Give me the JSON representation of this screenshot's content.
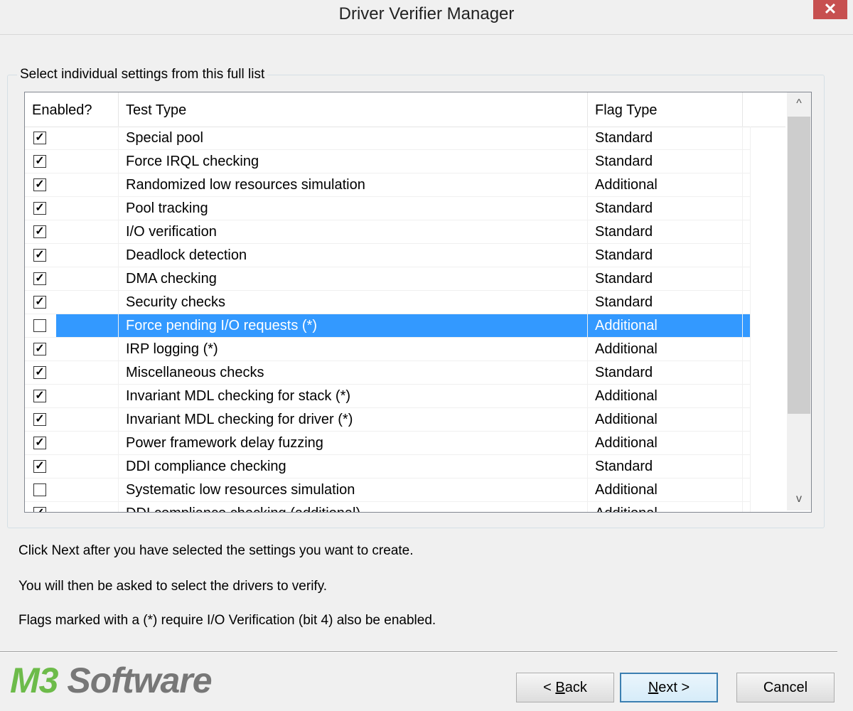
{
  "window": {
    "title": "Driver Verifier Manager",
    "close_glyph": "✕"
  },
  "group": {
    "label": "Select individual settings from this full list"
  },
  "columns": {
    "enabled": "Enabled?",
    "test_type": "Test Type",
    "flag_type": "Flag Type"
  },
  "rows": [
    {
      "checked": true,
      "test": "Special pool",
      "flag": "Standard"
    },
    {
      "checked": true,
      "test": "Force IRQL checking",
      "flag": "Standard"
    },
    {
      "checked": true,
      "test": "Randomized low resources simulation",
      "flag": "Additional"
    },
    {
      "checked": true,
      "test": "Pool tracking",
      "flag": "Standard"
    },
    {
      "checked": true,
      "test": "I/O verification",
      "flag": "Standard"
    },
    {
      "checked": true,
      "test": "Deadlock detection",
      "flag": "Standard"
    },
    {
      "checked": true,
      "test": "DMA checking",
      "flag": "Standard"
    },
    {
      "checked": true,
      "test": "Security checks",
      "flag": "Standard"
    },
    {
      "checked": false,
      "test": "Force pending I/O requests (*)",
      "flag": "Additional",
      "selected": true
    },
    {
      "checked": true,
      "test": "IRP logging (*)",
      "flag": "Additional"
    },
    {
      "checked": true,
      "test": "Miscellaneous checks",
      "flag": "Standard"
    },
    {
      "checked": true,
      "test": "Invariant MDL checking for stack (*)",
      "flag": "Additional"
    },
    {
      "checked": true,
      "test": "Invariant MDL checking for driver (*)",
      "flag": "Additional"
    },
    {
      "checked": true,
      "test": "Power framework delay fuzzing",
      "flag": "Additional"
    },
    {
      "checked": true,
      "test": "DDI compliance checking",
      "flag": "Standard"
    },
    {
      "checked": false,
      "test": "Systematic low resources simulation",
      "flag": "Additional"
    },
    {
      "checked": true,
      "test": "DDI compliance checking (additional)",
      "flag": "Additional"
    }
  ],
  "scrollbar": {
    "up_glyph": "^",
    "down_glyph": "v"
  },
  "info": {
    "line1": "Click Next after you have selected the settings you want to create.",
    "line2": "You will then be asked to select the drivers to verify.",
    "line3": "Flags marked with a (*) require I/O Verification (bit 4) also be enabled."
  },
  "logo": {
    "part1": "M3",
    "part2": " Software"
  },
  "buttons": {
    "back_prefix": "< ",
    "back_accel": "B",
    "back_rest": "ack",
    "next_accel": "N",
    "next_rest": "ext >",
    "cancel": "Cancel"
  },
  "colors": {
    "selection": "#3399ff",
    "logo_green": "#6dbb4a",
    "logo_gray": "#777777",
    "close_red": "#c75050"
  }
}
